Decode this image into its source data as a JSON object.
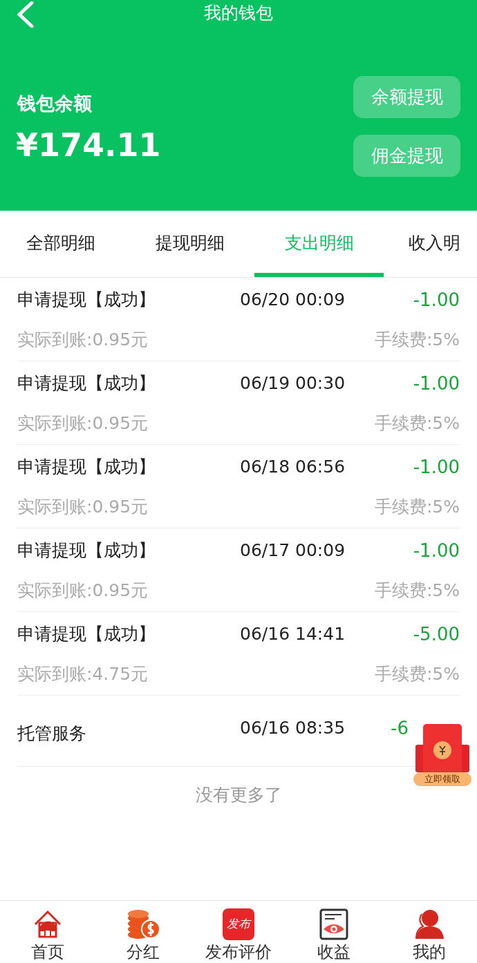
{
  "header": {
    "title": "我的钱包",
    "balance_label": "钱包余额",
    "balance": "¥174.11",
    "buttons": [
      "余额提现",
      "佣金提现"
    ]
  },
  "tabs": [
    {
      "label": "全部明细",
      "selected": false
    },
    {
      "label": "提现明细",
      "selected": false
    },
    {
      "label": "支出明细",
      "selected": true
    },
    {
      "label": "收入明",
      "selected": false
    }
  ],
  "records": [
    {
      "kind": "withdrawal",
      "title": "申请提现【成功】",
      "time": "06/20 00:09",
      "amount": "-1.00",
      "received": "实际到账:0.95元",
      "fee": "手续费:5%"
    },
    {
      "kind": "withdrawal",
      "title": "申请提现【成功】",
      "time": "06/19 00:30",
      "amount": "-1.00",
      "received": "实际到账:0.95元",
      "fee": "手续费:5%"
    },
    {
      "kind": "withdrawal",
      "title": "申请提现【成功】",
      "time": "06/18 06:56",
      "amount": "-1.00",
      "received": "实际到账:0.95元",
      "fee": "手续费:5%"
    },
    {
      "kind": "withdrawal",
      "title": "申请提现【成功】",
      "time": "06/17 00:09",
      "amount": "-1.00",
      "received": "实际到账:0.95元",
      "fee": "手续费:5%"
    },
    {
      "kind": "withdrawal",
      "title": "申请提现【成功】",
      "time": "06/16 14:41",
      "amount": "-5.00",
      "received": "实际到账:4.75元",
      "fee": "手续费:5%"
    },
    {
      "kind": "service",
      "title": "托管服务",
      "time": "06/16 08:35",
      "amount": "-6"
    }
  ],
  "end_note": "没有更多了",
  "red_packet": {
    "label": "立即领取"
  },
  "bottom_nav": [
    {
      "kind": "home",
      "label": "首页"
    },
    {
      "kind": "coins",
      "label": "分红"
    },
    {
      "kind": "publish",
      "label": "发布评价",
      "icon_text": "发布"
    },
    {
      "kind": "earnings",
      "label": "收益"
    },
    {
      "kind": "profile",
      "label": "我的"
    }
  ]
}
